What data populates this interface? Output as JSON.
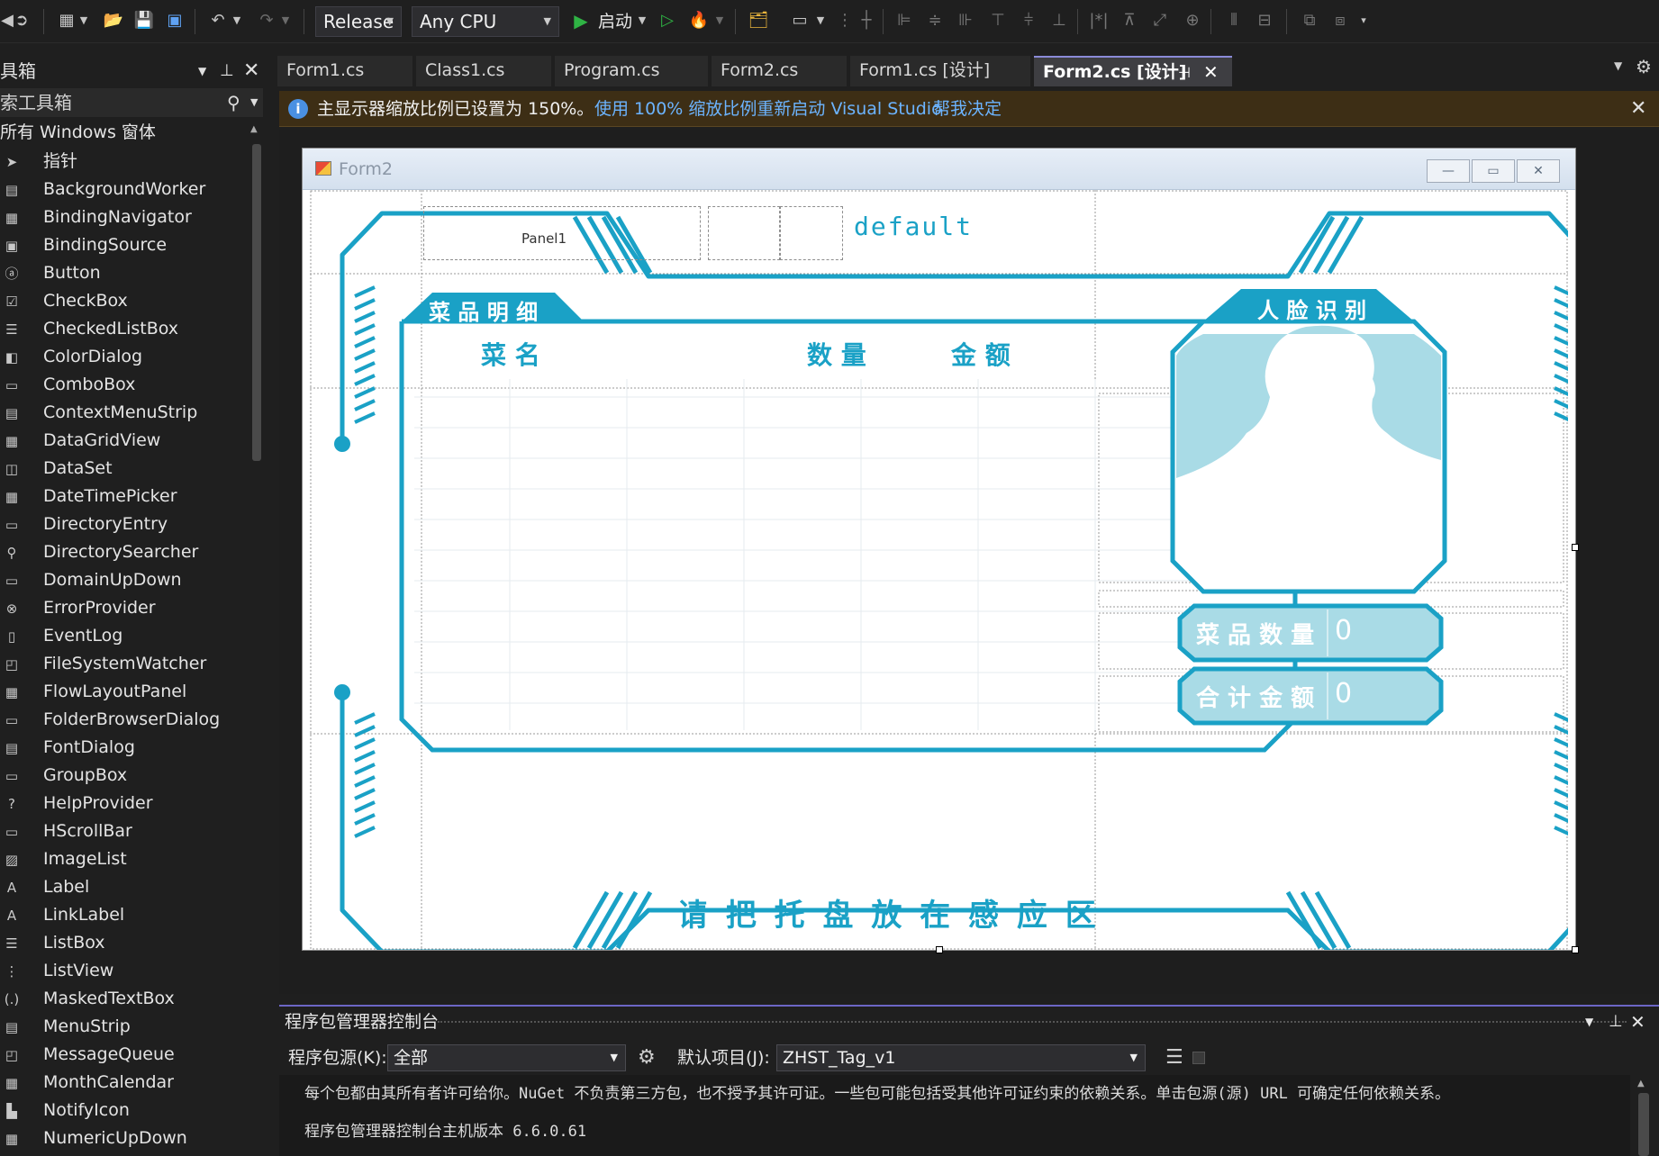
{
  "toolbar": {
    "config": "Release",
    "platform": "Any CPU",
    "start_label": "启动"
  },
  "toolbox": {
    "title": "具箱",
    "search_placeholder": "索工具箱",
    "group": "所有 Windows 窗体",
    "items": [
      {
        "label": "指针",
        "icon": "pointer-icon",
        "glyph": "➤"
      },
      {
        "label": "BackgroundWorker",
        "icon": "backgroundworker-icon",
        "glyph": "▤"
      },
      {
        "label": "BindingNavigator",
        "icon": "bindingnavigator-icon",
        "glyph": "▦"
      },
      {
        "label": "BindingSource",
        "icon": "bindingsource-icon",
        "glyph": "▣"
      },
      {
        "label": "Button",
        "icon": "button-icon",
        "glyph": "ⓐ"
      },
      {
        "label": "CheckBox",
        "icon": "checkbox-icon",
        "glyph": "☑"
      },
      {
        "label": "CheckedListBox",
        "icon": "checkedlistbox-icon",
        "glyph": "☰"
      },
      {
        "label": "ColorDialog",
        "icon": "colordialog-icon",
        "glyph": "◧"
      },
      {
        "label": "ComboBox",
        "icon": "combobox-icon",
        "glyph": "▭"
      },
      {
        "label": "ContextMenuStrip",
        "icon": "contextmenustrip-icon",
        "glyph": "▤"
      },
      {
        "label": "DataGridView",
        "icon": "datagridview-icon",
        "glyph": "▦"
      },
      {
        "label": "DataSet",
        "icon": "dataset-icon",
        "glyph": "◫"
      },
      {
        "label": "DateTimePicker",
        "icon": "datetimepicker-icon",
        "glyph": "▦"
      },
      {
        "label": "DirectoryEntry",
        "icon": "directoryentry-icon",
        "glyph": "▭"
      },
      {
        "label": "DirectorySearcher",
        "icon": "directorysearcher-icon",
        "glyph": "⚲"
      },
      {
        "label": "DomainUpDown",
        "icon": "domainupdown-icon",
        "glyph": "▭"
      },
      {
        "label": "ErrorProvider",
        "icon": "errorprovider-icon",
        "glyph": "⊗"
      },
      {
        "label": "EventLog",
        "icon": "eventlog-icon",
        "glyph": "▯"
      },
      {
        "label": "FileSystemWatcher",
        "icon": "filesystemwatcher-icon",
        "glyph": "◰"
      },
      {
        "label": "FlowLayoutPanel",
        "icon": "flowlayoutpanel-icon",
        "glyph": "▦"
      },
      {
        "label": "FolderBrowserDialog",
        "icon": "folderbrowserdialog-icon",
        "glyph": "▭"
      },
      {
        "label": "FontDialog",
        "icon": "fontdialog-icon",
        "glyph": "▤"
      },
      {
        "label": "GroupBox",
        "icon": "groupbox-icon",
        "glyph": "▭"
      },
      {
        "label": "HelpProvider",
        "icon": "helpprovider-icon",
        "glyph": "?"
      },
      {
        "label": "HScrollBar",
        "icon": "hscrollbar-icon",
        "glyph": "▭"
      },
      {
        "label": "ImageList",
        "icon": "imagelist-icon",
        "glyph": "▨"
      },
      {
        "label": "Label",
        "icon": "label-icon",
        "glyph": "A"
      },
      {
        "label": "LinkLabel",
        "icon": "linklabel-icon",
        "glyph": "A"
      },
      {
        "label": "ListBox",
        "icon": "listbox-icon",
        "glyph": "☰"
      },
      {
        "label": "ListView",
        "icon": "listview-icon",
        "glyph": "⋮"
      },
      {
        "label": "MaskedTextBox",
        "icon": "maskedtextbox-icon",
        "glyph": "(.)"
      },
      {
        "label": "MenuStrip",
        "icon": "menustrip-icon",
        "glyph": "▤"
      },
      {
        "label": "MessageQueue",
        "icon": "messagequeue-icon",
        "glyph": "◰"
      },
      {
        "label": "MonthCalendar",
        "icon": "monthcalendar-icon",
        "glyph": "▦"
      },
      {
        "label": "NotifyIcon",
        "icon": "notifyicon-icon",
        "glyph": "▙"
      },
      {
        "label": "NumericUpDown",
        "icon": "numericupdown-icon",
        "glyph": "▦"
      }
    ]
  },
  "tabs": [
    {
      "label": "Form1.cs",
      "active": false
    },
    {
      "label": "Class1.cs",
      "active": false
    },
    {
      "label": "Program.cs",
      "active": false
    },
    {
      "label": "Form2.cs",
      "active": false
    },
    {
      "label": "Form1.cs [设计]",
      "active": false
    },
    {
      "label": "Form2.cs [设计]",
      "active": true
    }
  ],
  "infobar": {
    "message": "主显示器缩放比例已设置为 150%。",
    "action_restart": "使用 100% 缩放比例重新启动 Visual Studio",
    "action_help": "帮我决定"
  },
  "form": {
    "title": "Form2",
    "panel_label": "Panel1",
    "default_label": "default",
    "dish_detail_title": "菜 品 明 细",
    "col_name": "菜 名",
    "col_qty": "数 量",
    "col_amount": "金 额",
    "face_title": "人 脸 识 别",
    "dish_count_label": "菜 品 数 量",
    "dish_count_value": "0",
    "total_label": "合 计 金 额",
    "total_value": "0",
    "tray_prompt": "请 把 托 盘 放 在 感 应 区",
    "accent_color": "#1aa1c6",
    "fill_color": "#a9dbe6"
  },
  "pmc": {
    "title": "程序包管理器控制台",
    "source_label": "程序包源(K):",
    "source_value": "全部",
    "project_label": "默认项目(J):",
    "project_value": "ZHST_Tag_v1",
    "line1": "每个包都由其所有者许可给你。NuGet 不负责第三方包，也不授予其许可证。一些包可能包括受其他许可证约束的依赖关系。单击包源(源) URL 可确定任何依赖关系。",
    "line2": "程序包管理器控制台主机版本 6.6.0.61"
  }
}
